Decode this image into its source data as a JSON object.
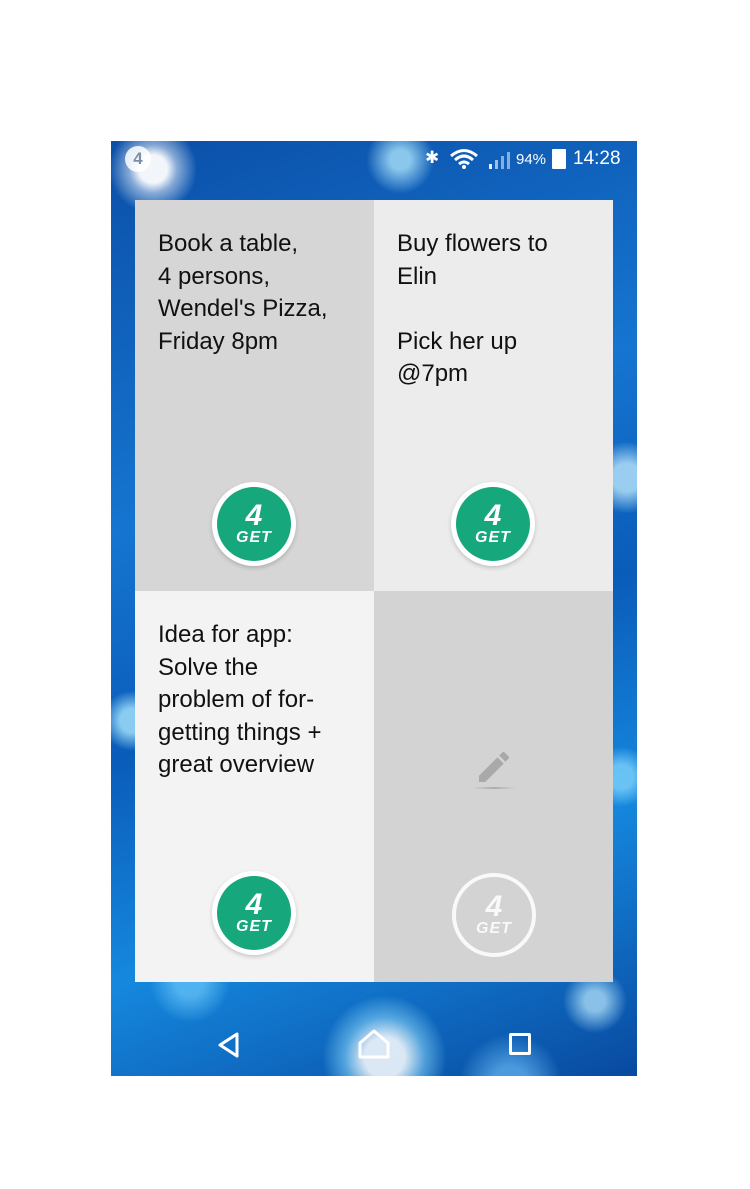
{
  "status_bar": {
    "app_badge": "4",
    "battery_percent": "94%",
    "time": "14:28",
    "icons": [
      "bluetooth-icon",
      "wifi-icon",
      "signal-icon",
      "battery-icon"
    ]
  },
  "notes": [
    {
      "text": "Book a table,\n4 persons,\nWendel's Pizza,\nFriday 8pm",
      "bg": "#d6d6d6",
      "logo_active": true
    },
    {
      "text": "Buy flowers to\nElin\n\nPick her up\n@7pm",
      "bg": "#ececec",
      "logo_active": true
    },
    {
      "text": "Idea for app:\nSolve the\nproblem of for-\ngetting things +\ngreat overview",
      "bg": "#f3f3f3",
      "logo_active": true
    },
    {
      "text": "",
      "bg": "#d3d3d3",
      "logo_active": false,
      "icon": "pencil-icon"
    }
  ],
  "logo": {
    "number": "4",
    "word": "GET",
    "color": "#16a77c"
  },
  "nav_bar": {
    "icons": [
      "back-icon",
      "home-icon",
      "recents-icon"
    ]
  }
}
